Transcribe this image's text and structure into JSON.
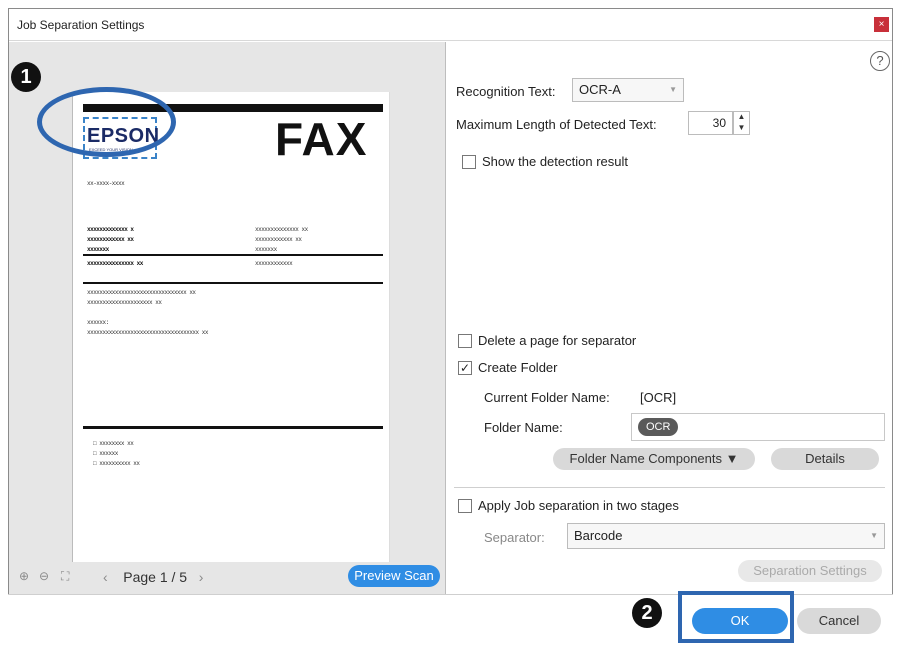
{
  "window": {
    "title": "Job Separation Settings",
    "close_glyph": "×"
  },
  "preview": {
    "logo_text": "EPSON",
    "logo_tagline": "EXCEED YOUR VISION",
    "fax_heading": "FAX",
    "lines": {
      "l0": "xx-xxxx-xxxx",
      "a1": "xxxxxxxxxxxxx x",
      "a2": "xxxxxxxxxxxx xx",
      "a3": "xxxxxxx",
      "a4": "xxxxxxxxxxxxxxx xx",
      "b1": "xxxxxxxxxxxxxx xx",
      "b2": "xxxxxxxxxxxx xx",
      "b3": "xxxxxxx",
      "b4": "xxxxxxxxxxxx",
      "c1": "xxxxxxxxxxxxxxxxxxxxxxxxxxxxxxxx xx",
      "c2": "xxxxxxxxxxxxxxxxxxxxx xx",
      "c3": "xxxxxx:",
      "c4": "xxxxxxxxxxxxxxxxxxxxxxxxxxxxxxxxxxxx xx",
      "d1": "□ xxxxxxxx xx",
      "d2": "□ xxxxxx",
      "d3": "□ xxxxxxxxxx xx"
    },
    "page_label": "Page 1 / 5",
    "preview_scan_label": "Preview Scan"
  },
  "callouts": {
    "one": "1",
    "two": "2"
  },
  "settings": {
    "help_glyph": "?",
    "recognition_text_label": "Recognition Text:",
    "recognition_text_value": "OCR-A",
    "max_length_label": "Maximum Length of Detected Text:",
    "max_length_value": "30",
    "show_detection_label": "Show the detection result",
    "delete_page_label": "Delete a page for separator",
    "create_folder_label": "Create Folder",
    "create_folder_checked": true,
    "current_folder_label": "Current Folder Name:",
    "current_folder_value": "[OCR]",
    "folder_name_label": "Folder Name:",
    "folder_name_chip": "OCR",
    "folder_components_label": "Folder Name Components ▼",
    "details_label": "Details",
    "two_stages_label": "Apply Job separation in two stages",
    "separator_label": "Separator:",
    "separator_value": "Barcode",
    "separation_settings_label": "Separation Settings"
  },
  "footer": {
    "ok_label": "OK",
    "cancel_label": "Cancel"
  },
  "colors": {
    "accent": "#2f8de4",
    "callout_ring": "#2e66b0",
    "close": "#c8303a"
  }
}
